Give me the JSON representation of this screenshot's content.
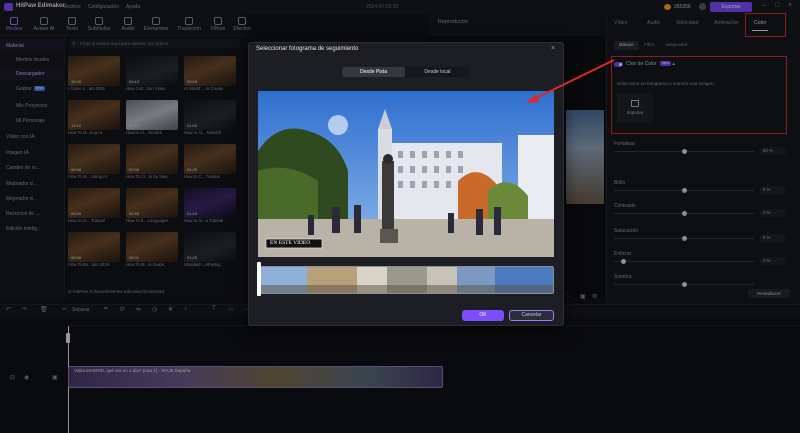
{
  "app": {
    "name": "HitPaw Edimakor",
    "menu": [
      "Archivo",
      "Configuración",
      "Ayuda"
    ],
    "datetime": "2024-07-25 01",
    "coins": "265356",
    "export_label": "Exportar",
    "window_controls": [
      "minimize-icon",
      "maximize-icon",
      "close-icon"
    ]
  },
  "tool_tabs": [
    {
      "label": "Medios",
      "icon": "media-icon",
      "active": true
    },
    {
      "label": "Avatar AI",
      "icon": "avatar-icon",
      "active": false
    },
    {
      "label": "Texto",
      "icon": "text-icon",
      "active": false
    },
    {
      "label": "Subtítulos",
      "icon": "subtitles-icon",
      "active": false
    },
    {
      "label": "Audio",
      "icon": "audio-icon",
      "active": false
    },
    {
      "label": "Elementos",
      "icon": "elements-icon",
      "active": false
    },
    {
      "label": "Transición",
      "icon": "transition-icon",
      "active": false
    },
    {
      "label": "Filtros",
      "icon": "filters-icon",
      "active": false
    },
    {
      "label": "Efectos",
      "icon": "effects-icon",
      "active": false
    }
  ],
  "left_nav": [
    {
      "label": "Material",
      "sub": false,
      "active": true
    },
    {
      "label": "Medios locales",
      "sub": true,
      "active": false
    },
    {
      "label": "Descargador",
      "sub": true,
      "active": true
    },
    {
      "label": "Grabar",
      "sub": true,
      "active": false,
      "badge": "New"
    },
    {
      "label": "Mis Proyectos",
      "sub": true,
      "active": false
    },
    {
      "label": "Mi Personaje",
      "sub": true,
      "active": false
    },
    {
      "label": "Vídeo con IA",
      "sub": false,
      "active": false
    },
    {
      "label": "Imagen IA",
      "sub": false,
      "active": false
    },
    {
      "label": "Cambio de ro...",
      "sub": false,
      "active": false
    },
    {
      "label": "Mejorador d...",
      "sub": false,
      "active": false
    },
    {
      "label": "Mejorador d...",
      "sub": false,
      "active": false
    },
    {
      "label": "Recursos de ...",
      "sub": false,
      "active": false
    },
    {
      "label": "Edición intelig...",
      "sub": false,
      "active": false
    }
  ],
  "media": {
    "search_placeholder": "Pega el enlace aquí para obtener los vídeos.",
    "path": "D:/HitPaw Software/HitPaw Edimakor/Download",
    "items": [
      {
        "dur": "10:28",
        "caption": "I Came A...ato 2026",
        "tone": "warm"
      },
      {
        "dur": "03:12",
        "caption": "How Cert...tion Video",
        "tone": "dark"
      },
      {
        "dur": "05:18",
        "caption": "AI World ... to Create",
        "tone": "warm"
      },
      {
        "dur": "13:10",
        "caption": "How To M...ring AI",
        "tone": "warm"
      },
      {
        "dur": "00:12",
        "caption": "How to Al... Nondol",
        "tone": "light"
      },
      {
        "dur": "01:02",
        "caption": "How AI Al... Nondoll",
        "tone": "dark"
      },
      {
        "dur": "06:08",
        "caption": "How To M... Using AI",
        "tone": "warm"
      },
      {
        "dur": "02:05",
        "caption": "How To Cr...te by Step",
        "tone": "warm"
      },
      {
        "dur": "04:25",
        "caption": "How to C... Tutorial",
        "tone": "warm"
      },
      {
        "dur": "00:59",
        "caption": "How to Cr... Tutorial",
        "tone": "warm"
      },
      {
        "dur": "02:55",
        "caption": "How To ll... Languages",
        "tone": "warm"
      },
      {
        "dur": "01:10",
        "caption": "How to Cr...e Tutorial",
        "tone": "purple"
      },
      {
        "dur": "08:58",
        "caption": "How To Bu...tion 2026",
        "tone": "warm"
      },
      {
        "dur": "06:01",
        "caption": "How To M...re Guide",
        "tone": "warm"
      },
      {
        "dur": "01:25",
        "caption": "Unsplash...HPaykig",
        "tone": "dark"
      }
    ]
  },
  "player": {
    "header": "Reproductor"
  },
  "right_panel": {
    "tabs": [
      "Vídeo",
      "Audio",
      "Velocidad",
      "Animación",
      "Color"
    ],
    "active_tab": "Color",
    "subtabs": [
      "Básico",
      "Filtro",
      "Mejorador"
    ],
    "active_subtab": "Básico",
    "color_match": {
      "label": "Clon de Color",
      "badge": "New",
      "hint": "Seleccione un fotograma o importe una imagen",
      "import_label": "Importar"
    },
    "sliders": [
      {
        "label": "Fortaleza",
        "value": "50 %",
        "level": 0.5
      },
      {
        "label": "Brillo",
        "value": "0 %",
        "level": 0.5
      },
      {
        "label": "Contraste",
        "value": "0 %",
        "level": 0.5
      },
      {
        "label": "Saturación",
        "value": "0 %",
        "level": 0.5
      },
      {
        "label": "Enfocar",
        "value": "0 %",
        "level": 0.05
      },
      {
        "label": "Sombra",
        "value": "",
        "level": 0.5
      }
    ],
    "reset_label": "Restablecer"
  },
  "timeline": {
    "split_label": "Separar",
    "clip_label": "Visita MADRID, qué ver en 1 día? (ruta 1) - VIAJE España",
    "toolbar_icons": [
      "undo-icon",
      "redo-icon",
      "delete-icon",
      "split-icon",
      "crop-icon",
      "rotate-icon",
      "mirror-icon",
      "speed-icon",
      "freeze-icon",
      "voice-icon",
      "text-icon",
      "caption-icon",
      "more-icon"
    ]
  },
  "dialog": {
    "title": "Seleccionar fotograma de seguimiento",
    "source_tabs": [
      "Desde Pista",
      "Desde local"
    ],
    "active_source": "Desde Pista",
    "preview_caption": "EN ESTE VIDEO",
    "ok_label": "OK",
    "cancel_label": "Cancelar"
  },
  "colors": {
    "accent": "#7c4dff",
    "highlight_box": "#e02727",
    "background": "#111318"
  }
}
